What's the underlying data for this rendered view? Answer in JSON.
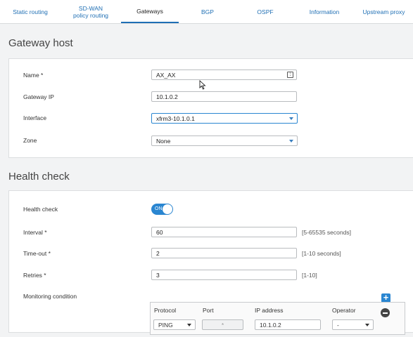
{
  "tabs": [
    {
      "label": "Static routing"
    },
    {
      "label": "SD-WAN policy routing"
    },
    {
      "label": "Gateways"
    },
    {
      "label": "BGP"
    },
    {
      "label": "OSPF"
    },
    {
      "label": "Information"
    },
    {
      "label": "Upstream proxy"
    }
  ],
  "active_tab": "Gateways",
  "gateway_host": {
    "title": "Gateway host",
    "name_label": "Name *",
    "name_value": "AX_AX",
    "gateway_ip_label": "Gateway IP",
    "gateway_ip_value": "10.1.0.2",
    "interface_label": "Interface",
    "interface_value": "xfrm3-10.1.0.1",
    "zone_label": "Zone",
    "zone_value": "None"
  },
  "health_check": {
    "title": "Health check",
    "toggle_label": "Health check",
    "toggle_text": "ON",
    "interval_label": "Interval *",
    "interval_value": "60",
    "interval_hint": "[5-65535 seconds]",
    "timeout_label": "Time-out *",
    "timeout_value": "2",
    "timeout_hint": "[1-10 seconds]",
    "retries_label": "Retries *",
    "retries_value": "3",
    "retries_hint": "[1-10]",
    "monitoring_label": "Monitoring condition",
    "columns": {
      "protocol": "Protocol",
      "port": "Port",
      "ip": "IP address",
      "operator": "Operator"
    },
    "row": {
      "protocol": "PING",
      "port": "*",
      "ip": "10.1.0.2",
      "operator": "-"
    }
  },
  "colors": {
    "accent": "#2a86d1",
    "link": "#1f6fb4"
  }
}
